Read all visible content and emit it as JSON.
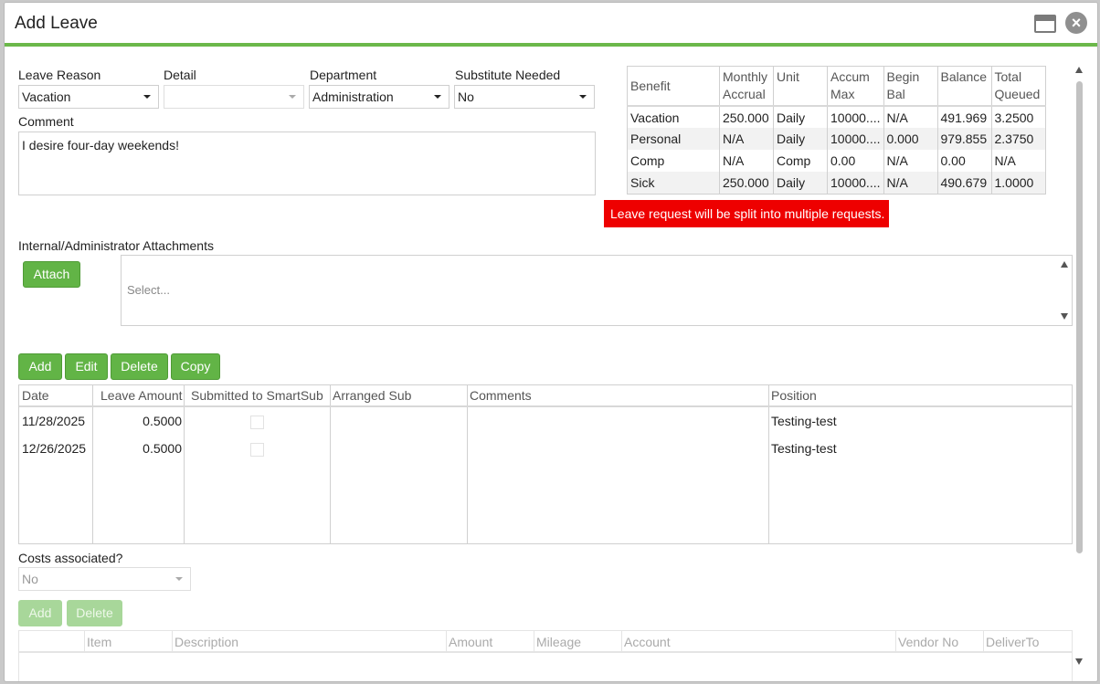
{
  "dialog": {
    "title": "Add Leave"
  },
  "form": {
    "leave_reason": {
      "label": "Leave Reason",
      "value": "Vacation"
    },
    "detail": {
      "label": "Detail",
      "value": ""
    },
    "department": {
      "label": "Department",
      "value": "Administration"
    },
    "substitute": {
      "label": "Substitute Needed",
      "value": "No"
    },
    "comment": {
      "label": "Comment",
      "value": "I desire four-day weekends!"
    }
  },
  "benefits": {
    "headers": [
      "Benefit",
      "Monthly Accrual",
      "Unit",
      "Accum Max",
      "Begin Bal",
      "Balance",
      "Total Queued"
    ],
    "rows": [
      [
        "Vacation",
        "250.000",
        "Daily",
        "10000....",
        "N/A",
        "491.969",
        "3.2500"
      ],
      [
        "Personal",
        "N/A",
        "Daily",
        "10000....",
        "0.000",
        "979.855",
        "2.3750"
      ],
      [
        "Comp",
        "N/A",
        "Comp",
        "0.00",
        "N/A",
        "0.00",
        "N/A"
      ],
      [
        "Sick",
        "250.000",
        "Daily",
        "10000....",
        "N/A",
        "490.679",
        "1.0000"
      ]
    ]
  },
  "alert": {
    "text": "Leave request will be split into multiple requests.",
    "color": "#ee0000"
  },
  "attachments": {
    "label": "Internal/Administrator Attachments",
    "attach_label": "Attach",
    "placeholder": "Select..."
  },
  "leave_toolbar": {
    "add": "Add",
    "edit": "Edit",
    "delete": "Delete",
    "copy": "Copy"
  },
  "leave_grid": {
    "headers": [
      "Date",
      "Leave Amount",
      "Submitted to SmartSub",
      "Arranged Sub",
      "Comments",
      "Position"
    ],
    "rows": [
      {
        "date": "11/28/2025",
        "amount": "0.5000",
        "submitted": false,
        "arranged": "",
        "comments": "",
        "position": "Testing-test"
      },
      {
        "date": "12/26/2025",
        "amount": "0.5000",
        "submitted": false,
        "arranged": "",
        "comments": "",
        "position": "Testing-test"
      }
    ]
  },
  "costs": {
    "label": "Costs associated?",
    "value": "No",
    "add": "Add",
    "delete": "Delete",
    "headers": [
      "Item",
      "Description",
      "Amount",
      "Mileage",
      "Account",
      "Vendor No",
      "DeliverTo"
    ]
  },
  "colors": {
    "accent": "#6bb84a",
    "button": "#62b446"
  }
}
